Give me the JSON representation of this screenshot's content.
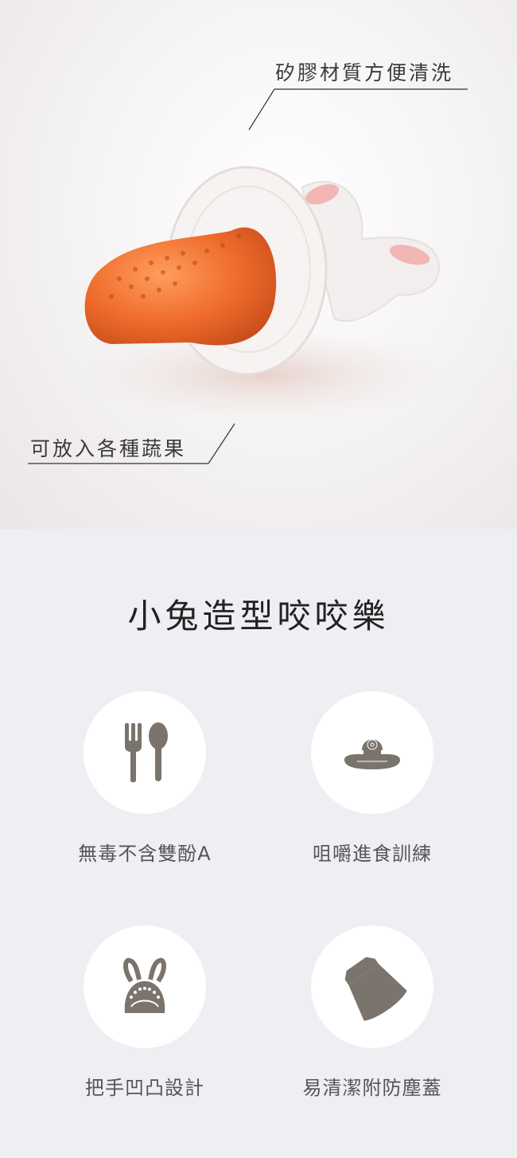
{
  "hero": {
    "callout_top": "矽膠材質方便清洗",
    "callout_bottom": "可放入各種蔬果"
  },
  "section": {
    "title": "小兔造型咬咬樂"
  },
  "features": [
    {
      "icon": "utensils-icon",
      "label": "無毒不含雙酚A"
    },
    {
      "icon": "nipple-icon",
      "label": "咀嚼進食訓練"
    },
    {
      "icon": "bunny-handle-icon",
      "label": "把手凹凸設計"
    },
    {
      "icon": "dust-cover-icon",
      "label": "易清潔附防塵蓋"
    }
  ],
  "colors": {
    "icon": "#7a746c",
    "background": "#eeeff3",
    "circle": "#ffffff"
  }
}
